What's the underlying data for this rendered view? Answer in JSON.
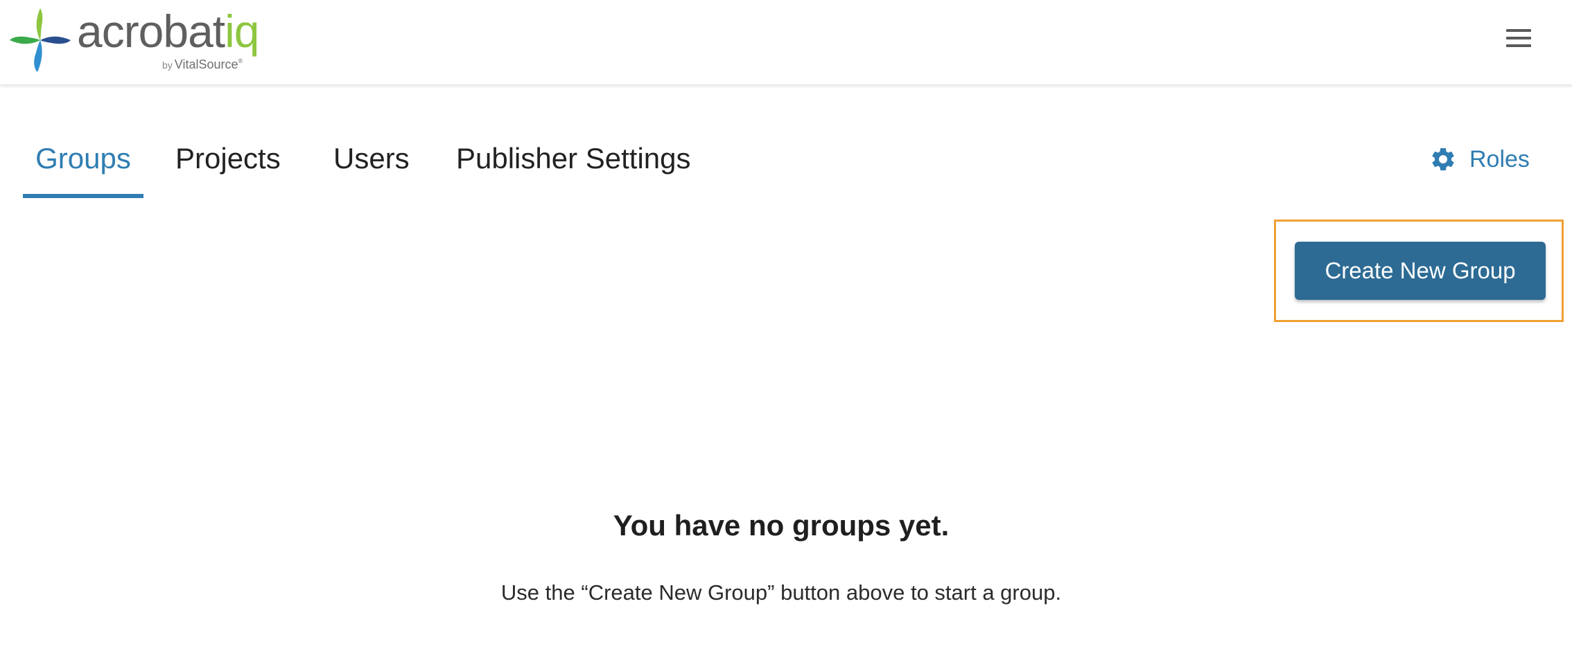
{
  "header": {
    "logo": {
      "word_main": "acrobat",
      "word_accent": "iq",
      "byline_by": "by",
      "byline_brand": "VitalSource",
      "trademark": "®"
    },
    "menu_icon": "hamburger-menu-icon"
  },
  "tabs": [
    {
      "label": "Groups",
      "active": true
    },
    {
      "label": "Projects",
      "active": false
    },
    {
      "label": "Users",
      "active": false
    },
    {
      "label": "Publisher Settings",
      "active": false
    }
  ],
  "roles": {
    "label": "Roles",
    "icon": "gear-icon"
  },
  "actions": {
    "create_label": "Create New Group"
  },
  "empty_state": {
    "title": "You have no groups yet.",
    "message": "Use the “Create New Group” button above to start a group."
  },
  "colors": {
    "accent": "#2f7db2",
    "button": "#2d6b94",
    "highlight": "#f0a033",
    "logo_green": "#8dc63f",
    "logo_gray": "#5f5f5f"
  }
}
